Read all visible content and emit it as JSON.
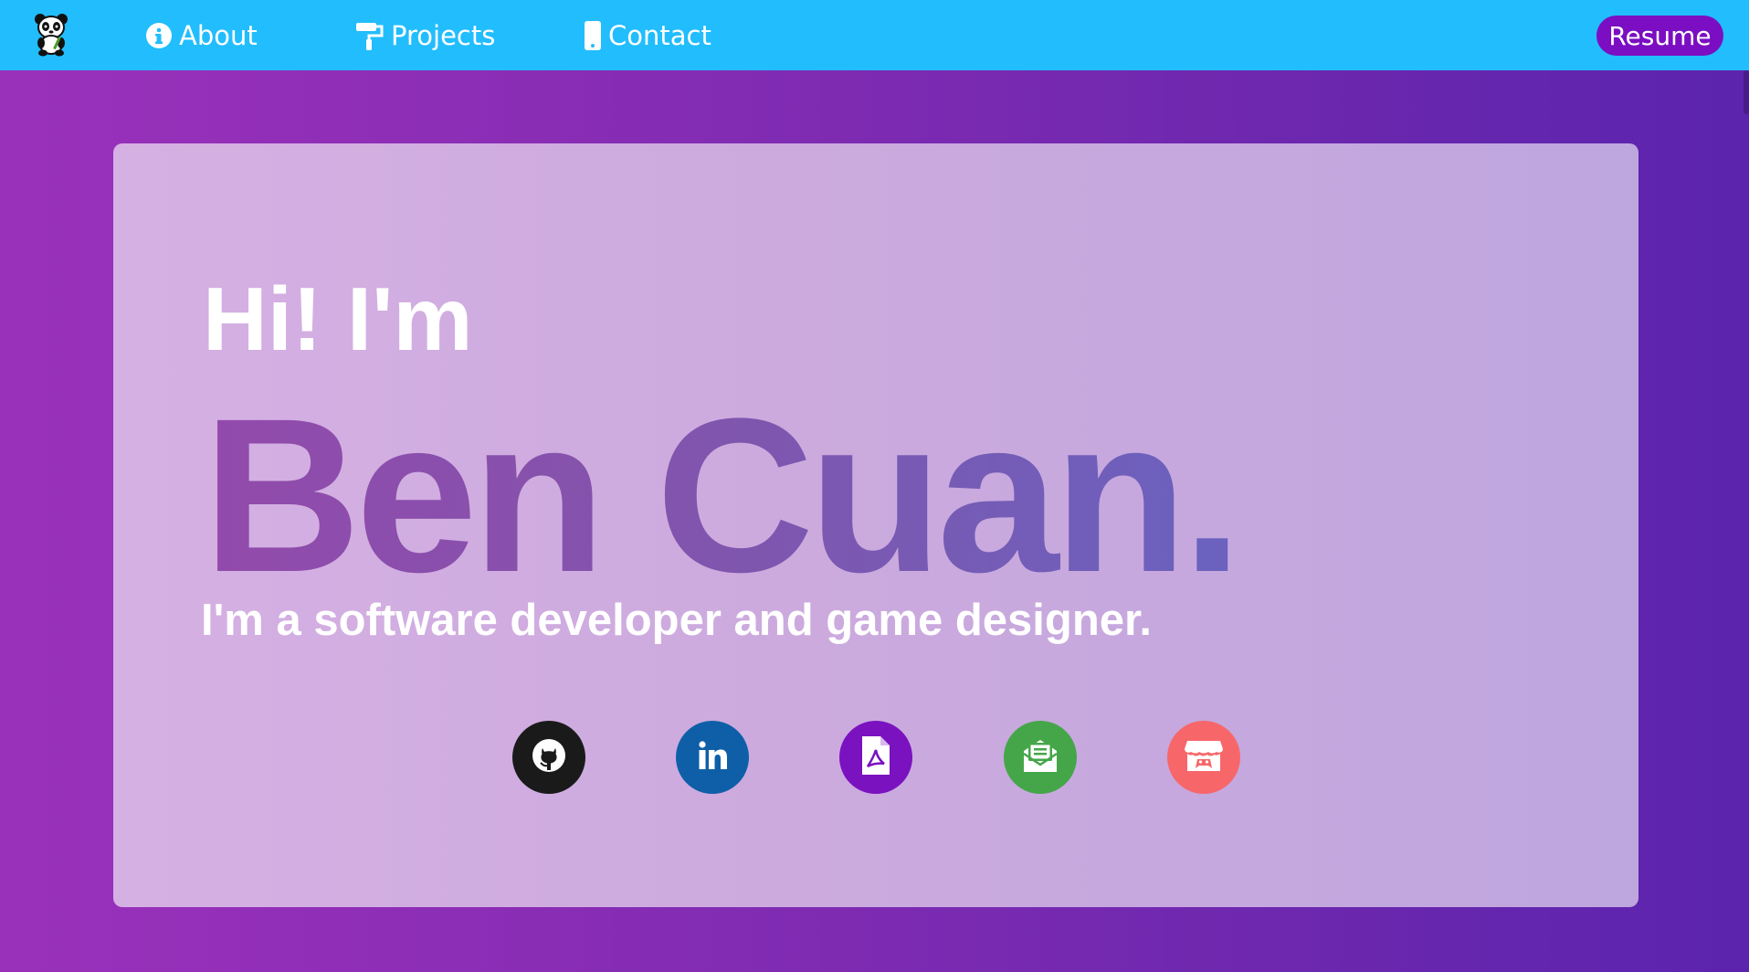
{
  "nav": {
    "logo_icon": "panda-icon",
    "links": [
      {
        "label": "About",
        "icon": "info-icon"
      },
      {
        "label": "Projects",
        "icon": "paint-roller-icon"
      },
      {
        "label": "Contact",
        "icon": "mobile-phone-icon"
      }
    ],
    "resume_label": "Resume"
  },
  "hero": {
    "greeting": "Hi! I'm",
    "name": "Ben Cuan.",
    "tagline": "I'm a software developer and game designer."
  },
  "social": [
    {
      "icon": "github-icon",
      "color": "#1a1a1a"
    },
    {
      "icon": "linkedin-icon",
      "color": "#0f5fa8"
    },
    {
      "icon": "pdf-file-icon",
      "color": "#7a12c0"
    },
    {
      "icon": "mail-open-icon",
      "color": "#45a649"
    },
    {
      "icon": "itch-io-icon",
      "color": "#f7676a"
    }
  ],
  "colors": {
    "navbar": "#22bdfd",
    "resume_button": "#7b0ec2",
    "background_start": "#9a31bb",
    "background_end": "#5b24ad"
  }
}
